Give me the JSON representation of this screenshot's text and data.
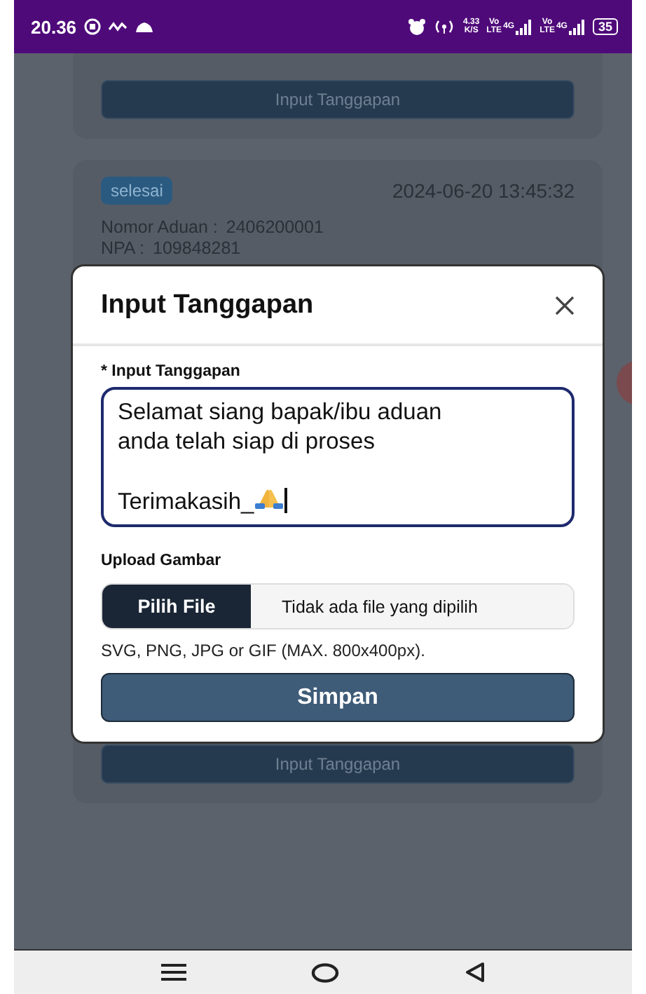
{
  "status_bar": {
    "time": "20.36",
    "speed": "4.33",
    "speed_unit": "K/S",
    "sims": [
      {
        "volte": "Vo",
        "lte": "LTE",
        "network": "4G"
      },
      {
        "volte": "Vo",
        "lte": "LTE",
        "network": "4G"
      }
    ],
    "battery": "35"
  },
  "cards": [
    {
      "kind": "partial",
      "button": "Input Tanggapan"
    },
    {
      "kind": "complaint",
      "status": "selesai",
      "datetime": "2024-06-20 13:45:32",
      "fields": [
        {
          "label": "Nomor Aduan :",
          "value": "2406200001"
        },
        {
          "label": "NPA :",
          "value": "109848281"
        }
      ],
      "button": "Input Tanggapan"
    }
  ],
  "modal": {
    "title": "Input Tanggapan",
    "field_label": "* Input Tanggapan",
    "value": "Selamat siang bapak/ibu aduan\nanda telah siap di proses\n\nTerimakasih_",
    "upload_label": "Upload Gambar",
    "file_button": "Pilih File",
    "file_status": "Tidak ada file yang dipilih",
    "hint": "SVG, PNG, JPG or GIF (MAX. 800x400px).",
    "submit": "Simpan"
  }
}
